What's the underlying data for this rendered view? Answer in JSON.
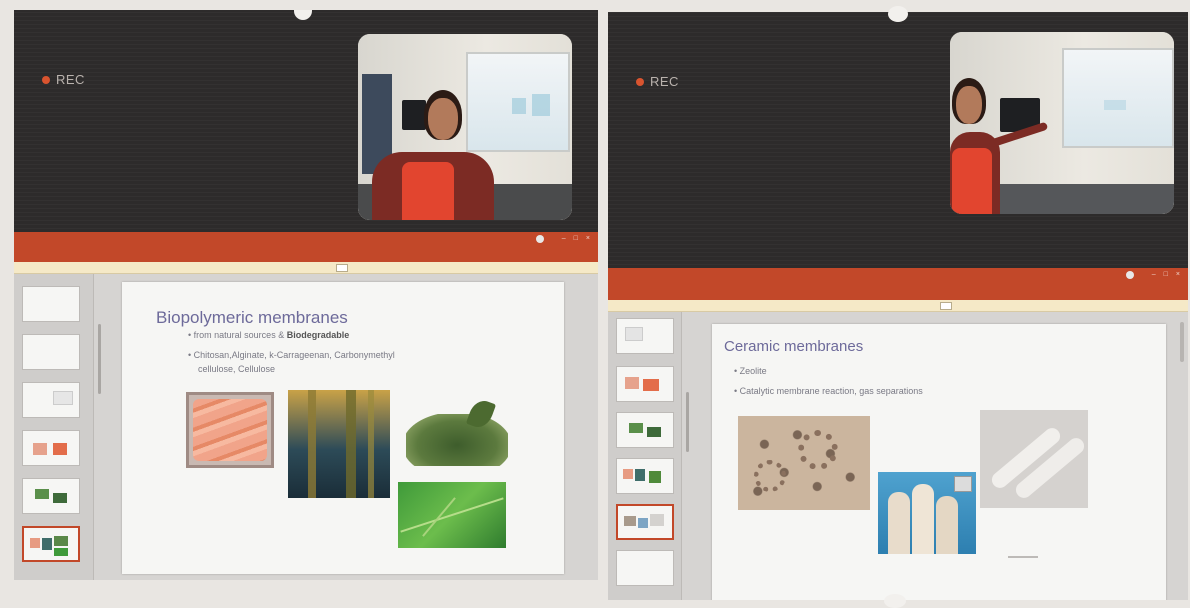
{
  "left": {
    "rec_label": "REC",
    "slide": {
      "title": "Biopolymeric membranes",
      "bullet1_prefix": "from natural sources & ",
      "bullet1_bold": "Biodegradable",
      "bullet2_line1": "Chitosan,Alginate, k-Carrageenan, Carbonymethyl",
      "bullet2_line2": "cellulose, Cellulose"
    },
    "thumbnail_count": 6,
    "active_thumbnail": 6
  },
  "right": {
    "rec_label": "REC",
    "slide": {
      "title": "Ceramic membranes",
      "bullet1": "Zeolite",
      "bullet2": "Catalytic membrane reaction, gas separations"
    },
    "thumbnail_count": 6,
    "active_thumbnail": 5
  },
  "colors": {
    "ribbon": "#c24829",
    "meeting_background": "#2d2b2b",
    "rec_dot": "#d9542f",
    "slide_title": "#6d6a9a"
  },
  "icons": [
    "rec-dot-icon",
    "user-avatar-icon",
    "window-controls-icon"
  ]
}
